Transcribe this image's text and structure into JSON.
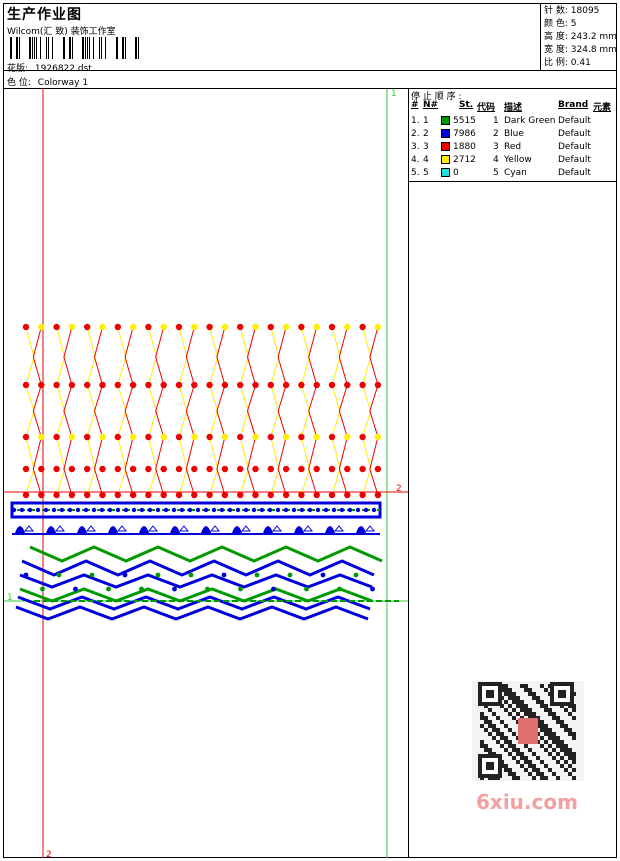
{
  "header": {
    "title": "生产作业图",
    "subtitle": "Wilcom(汇 致) 装饰工作室",
    "design_label": "花版:",
    "design_value": "1926822.dst",
    "color_label": "色 位:",
    "color_value": "Colorway 1"
  },
  "stats": {
    "stitches_label": "针 数:",
    "stitches": "18095",
    "colors_label": "颜 色:",
    "colors": "5",
    "height_label": "高 度:",
    "height": "243.2 mm",
    "width_label": "宽 度:",
    "width": "324.8 mm",
    "scale_label": "比 例:",
    "scale": "0.41"
  },
  "stop_sequence": {
    "label": "停 止 顺 序 :",
    "headers": [
      "#",
      "N#",
      "St.",
      "代码",
      "描述",
      "Brand",
      "元素"
    ],
    "rows": [
      {
        "num": "1.",
        "n": "1",
        "color": "#009900",
        "stitches": "5515",
        "code": "1",
        "desc": "Dark Green",
        "brand": "Default"
      },
      {
        "num": "2.",
        "n": "2",
        "color": "#0000dd",
        "stitches": "7986",
        "code": "2",
        "desc": "Blue",
        "brand": "Default"
      },
      {
        "num": "3.",
        "n": "3",
        "color": "#ee0000",
        "stitches": "1880",
        "code": "3",
        "desc": "Red",
        "brand": "Default"
      },
      {
        "num": "4.",
        "n": "4",
        "color": "#ffee00",
        "stitches": "2712",
        "code": "4",
        "desc": "Yellow",
        "brand": "Default"
      },
      {
        "num": "5.",
        "n": "5",
        "color": "#22dddd",
        "stitches": "0",
        "code": "5",
        "desc": "Cyan",
        "brand": "Default"
      }
    ]
  },
  "guides": {
    "top_right": "1",
    "right_mid": "2",
    "left_low": "1",
    "bottom_left": "2"
  },
  "watermark": {
    "text": "6xiu.com"
  }
}
